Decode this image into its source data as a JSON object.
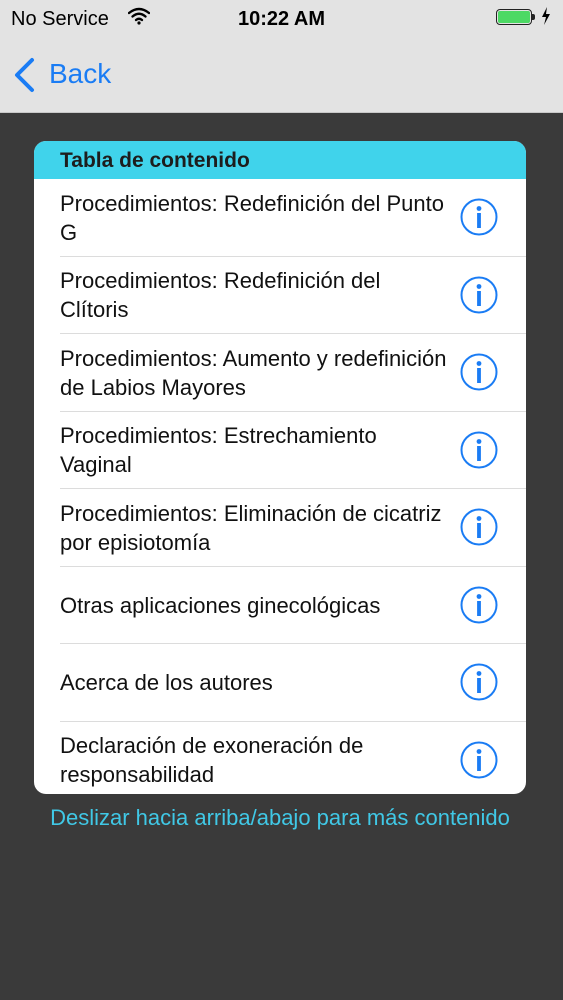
{
  "status_bar": {
    "carrier": "No Service",
    "time": "10:22 AM",
    "battery_level": 1.0,
    "battery_color": "#4cd964",
    "charging": true
  },
  "nav": {
    "back_label": "Back",
    "accent_color": "#1a7cf4"
  },
  "toc": {
    "title": "Tabla de contenido",
    "header_color": "#40d3eb",
    "items": [
      {
        "label": "Procedimientos: Redefinición del Punto G"
      },
      {
        "label": "Procedimientos: Redefinición del Clítoris"
      },
      {
        "label": "Procedimientos: Aumento y redefinición de Labios Mayores"
      },
      {
        "label": "Procedimientos: Estrechamiento Vaginal"
      },
      {
        "label": "Procedimientos: Eliminación de cicatriz por episiotomía"
      },
      {
        "label": "Otras aplicaciones ginecológicas"
      },
      {
        "label": "Acerca de los autores"
      },
      {
        "label": "Declaración de exoneración de responsabilidad"
      }
    ]
  },
  "hint": "Deslizar hacia arriba/abajo para más contenido"
}
